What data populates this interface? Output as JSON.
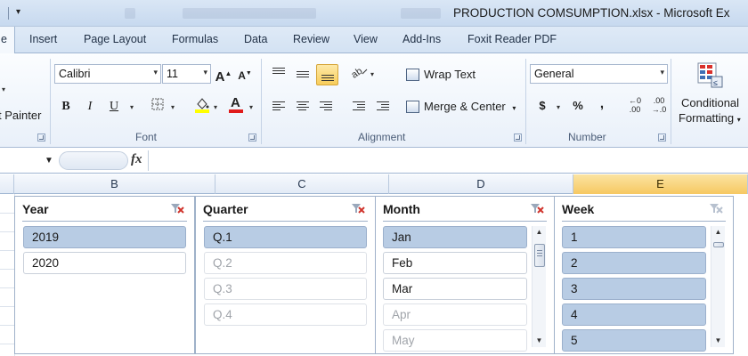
{
  "window": {
    "title": "PRODUCTION COMSUMPTION.xlsx - Microsoft Ex"
  },
  "tabs": [
    {
      "label": "e",
      "active": true
    },
    {
      "label": "Insert"
    },
    {
      "label": "Page Layout"
    },
    {
      "label": "Formulas"
    },
    {
      "label": "Data"
    },
    {
      "label": "Review"
    },
    {
      "label": "View"
    },
    {
      "label": "Add-Ins"
    },
    {
      "label": "Foxit Reader PDF"
    }
  ],
  "ribbon": {
    "clipboard": {
      "format_painter": "t Painter"
    },
    "font": {
      "name": "Calibri",
      "size": "11",
      "bold": "B",
      "italic": "I",
      "underline": "U",
      "grow": "A",
      "shrink": "A",
      "label": "Font"
    },
    "alignment": {
      "wrap_text": "Wrap Text",
      "merge_center": "Merge & Center",
      "label": "Alignment"
    },
    "number": {
      "format": "General",
      "currency": "$",
      "percent": "%",
      "comma": ",",
      "label": "Number"
    },
    "styles": {
      "conditional_line1": "Conditional",
      "conditional_line2": "Formatting"
    }
  },
  "formula_bar": {
    "fx": "fx",
    "value": ""
  },
  "columns": [
    {
      "label": "B",
      "selected": false
    },
    {
      "label": "C",
      "selected": false
    },
    {
      "label": "D",
      "selected": false
    },
    {
      "label": "E",
      "selected": true
    }
  ],
  "slicers": [
    {
      "title": "Year",
      "items": [
        {
          "label": "2019",
          "state": "selected"
        },
        {
          "label": "2020",
          "state": "normal"
        }
      ]
    },
    {
      "title": "Quarter",
      "items": [
        {
          "label": "Q.1",
          "state": "selected"
        },
        {
          "label": "Q.2",
          "state": "dim"
        },
        {
          "label": "Q.3",
          "state": "dim"
        },
        {
          "label": "Q.4",
          "state": "dim"
        }
      ]
    },
    {
      "title": "Month",
      "items": [
        {
          "label": "Jan",
          "state": "selected"
        },
        {
          "label": "Feb",
          "state": "normal"
        },
        {
          "label": "Mar",
          "state": "normal"
        },
        {
          "label": "Apr",
          "state": "dim"
        },
        {
          "label": "May",
          "state": "dim"
        }
      ]
    },
    {
      "title": "Week",
      "items": [
        {
          "label": "1",
          "state": "selected"
        },
        {
          "label": "2",
          "state": "selected"
        },
        {
          "label": "3",
          "state": "selected"
        },
        {
          "label": "4",
          "state": "selected"
        },
        {
          "label": "5",
          "state": "selected"
        }
      ]
    }
  ],
  "colors": {
    "selected_item": "#b8cce4",
    "selected_column": "#f6c862",
    "ribbon_bg": "#e9f0f9"
  }
}
